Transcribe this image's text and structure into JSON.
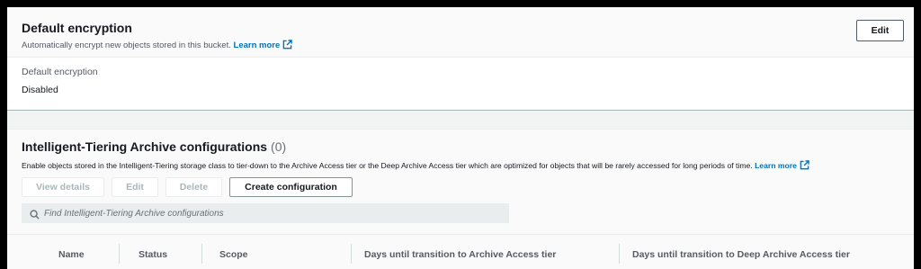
{
  "encryption": {
    "title": "Default encryption",
    "description": "Automatically encrypt new objects stored in this bucket.",
    "learn_more": "Learn more",
    "edit_label": "Edit",
    "field_label": "Default encryption",
    "field_value": "Disabled"
  },
  "tiering": {
    "title": "Intelligent-Tiering Archive configurations",
    "count": "(0)",
    "description": "Enable objects stored in the Intelligent-Tiering storage class to tier-down to the Archive Access tier or the Deep Archive Access tier which are optimized for objects that will be rarely accessed for long periods of time.",
    "learn_more": "Learn more",
    "buttons": {
      "view_details": "View details",
      "edit": "Edit",
      "delete": "Delete",
      "create": "Create configuration"
    },
    "search_placeholder": "Find Intelligent-Tiering Archive configurations",
    "columns": [
      "Name",
      "Status",
      "Scope",
      "Days until transition to Archive Access tier",
      "Days until transition to Deep Archive Access tier"
    ]
  },
  "colors": {
    "link": "#0073bb",
    "text": "#16191f",
    "muted": "#545b64",
    "disabled": "#aab7b8"
  },
  "icons": {
    "external_link": "external-link-icon",
    "search": "search-icon"
  }
}
